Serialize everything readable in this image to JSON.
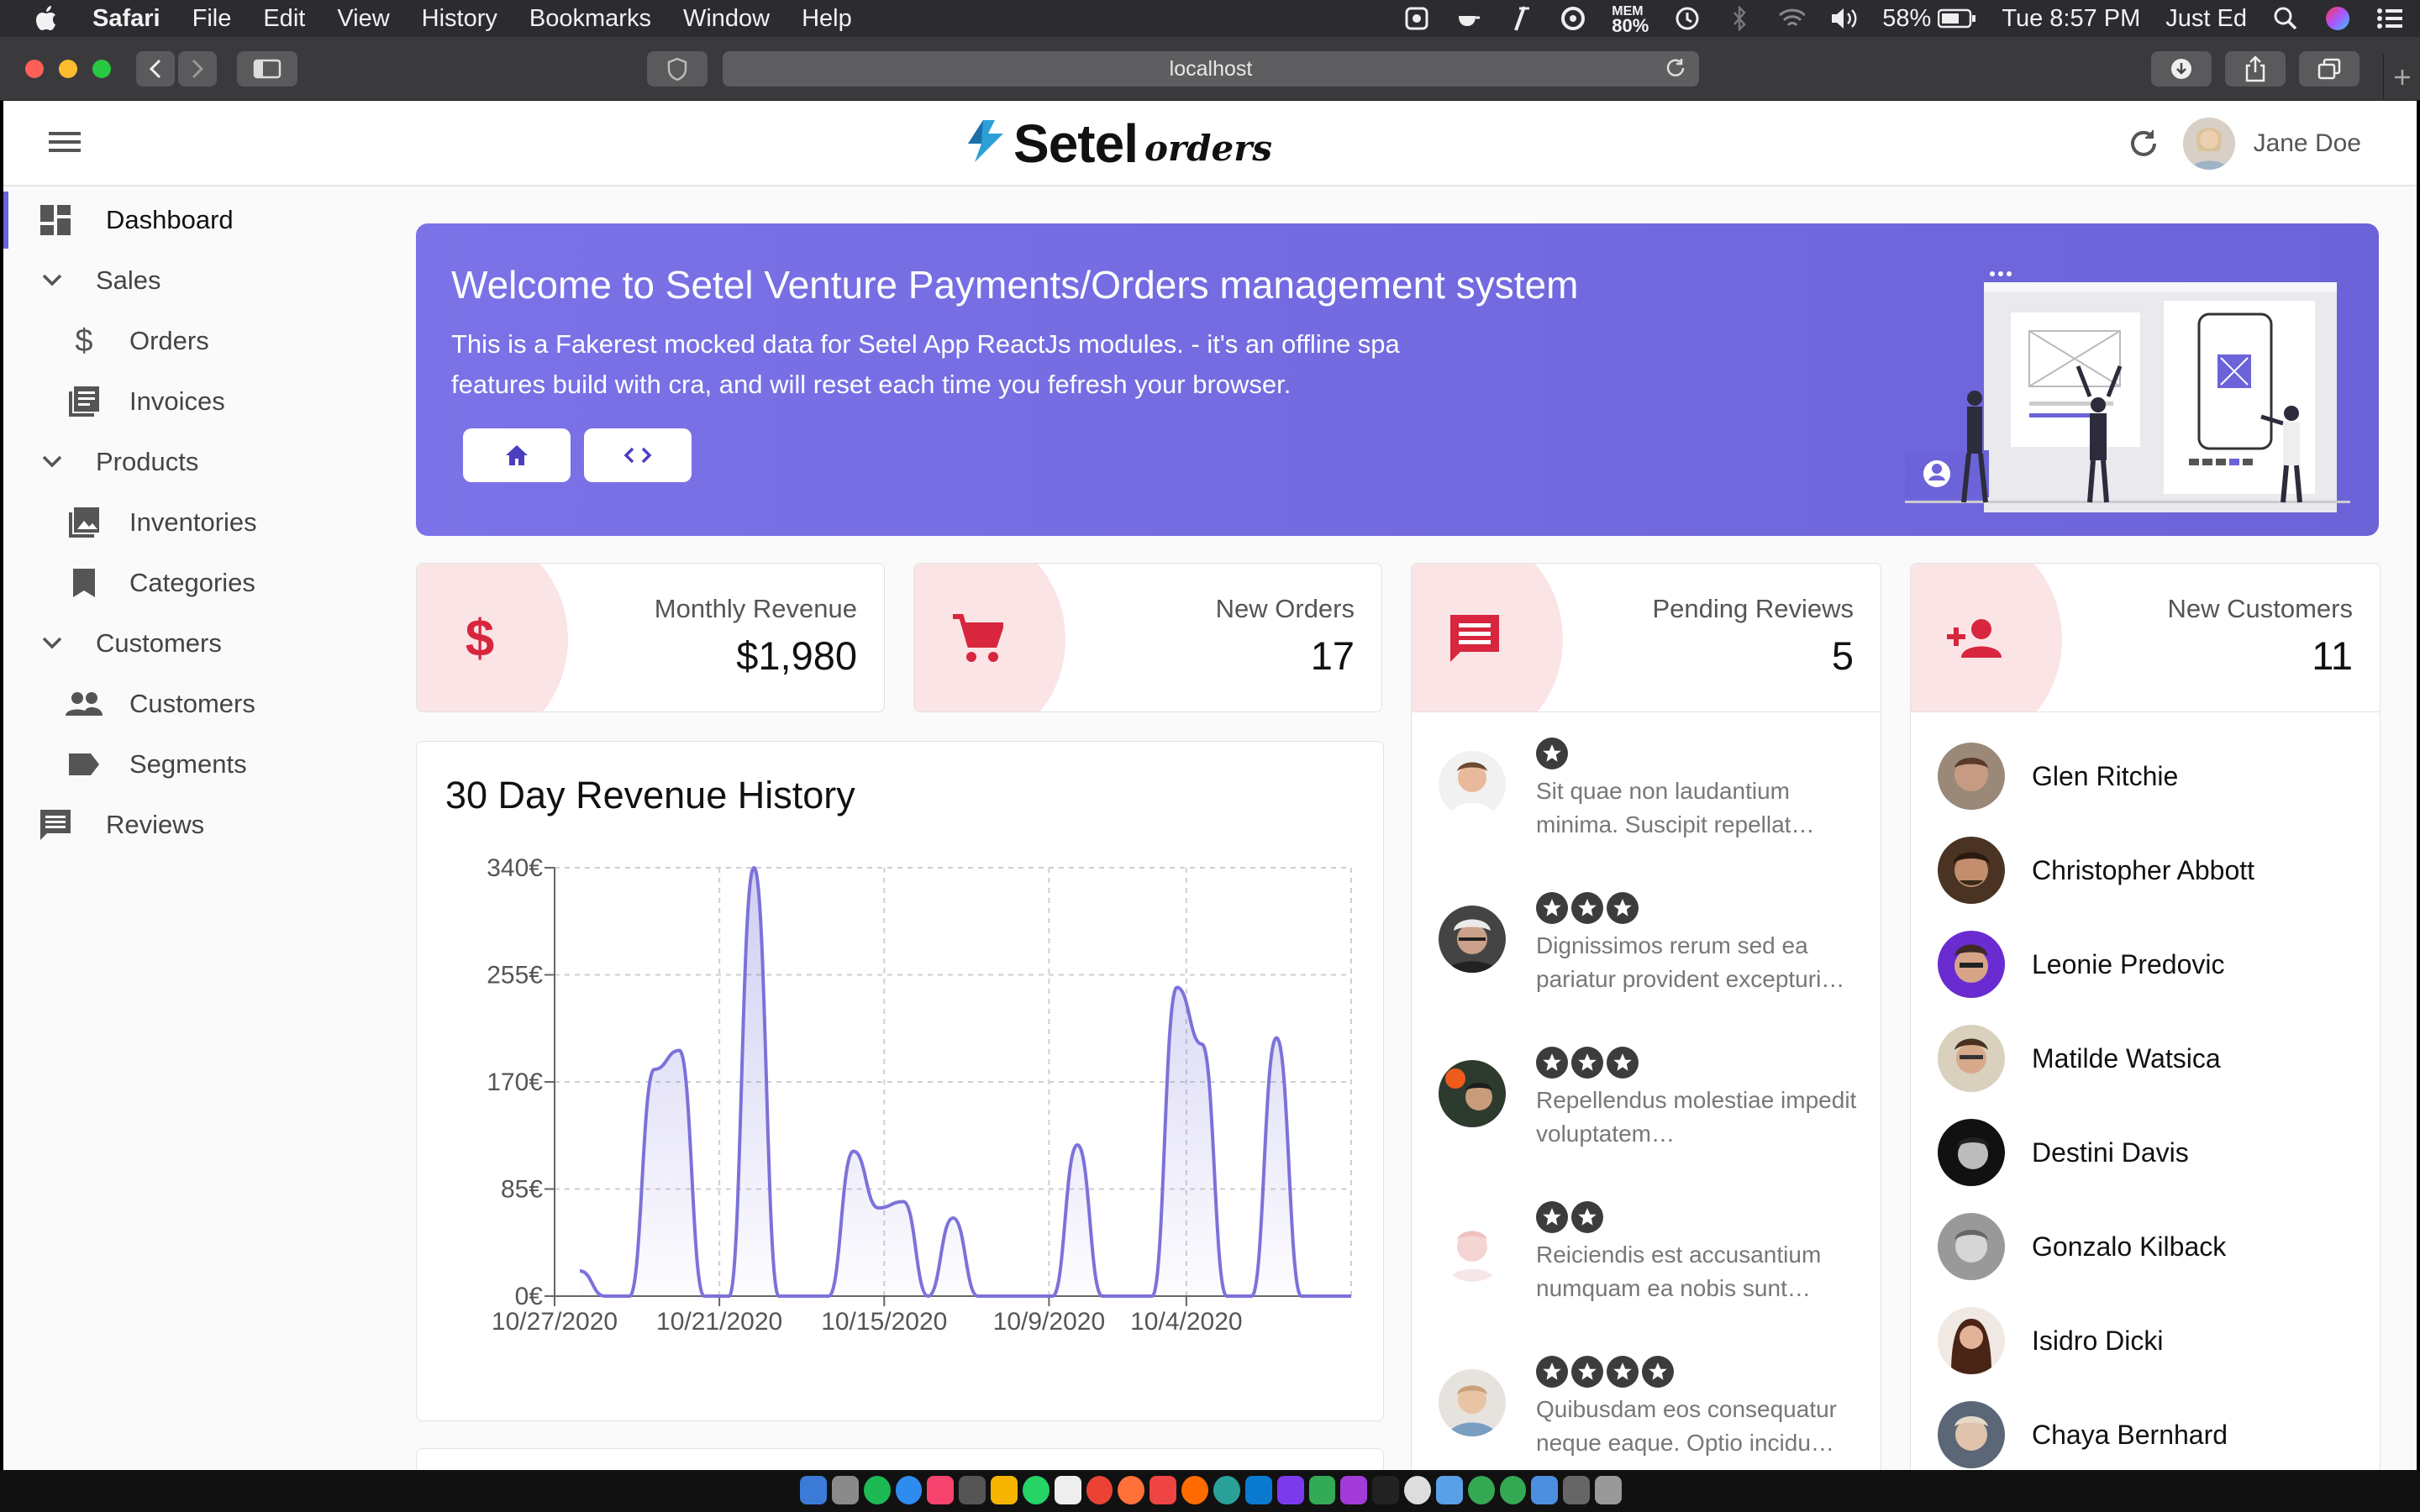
{
  "menubar": {
    "app_name": "Safari",
    "items": [
      "File",
      "Edit",
      "View",
      "History",
      "Bookmarks",
      "Window",
      "Help"
    ],
    "mem_label": "MEM",
    "mem_value": "80%",
    "battery": "58%",
    "datetime": "Tue 8:57 PM",
    "user": "Just Ed"
  },
  "browser": {
    "url": "localhost"
  },
  "header": {
    "logo_brand": "Setel",
    "logo_sub": "orders",
    "user_name": "Jane Doe"
  },
  "sidebar": {
    "items": [
      {
        "label": "Dashboard",
        "icon": "dashboard-icon"
      },
      {
        "label": "Sales",
        "icon": "chevron-down-icon"
      },
      {
        "label": "Orders",
        "icon": "dollar-icon"
      },
      {
        "label": "Invoices",
        "icon": "invoices-icon"
      },
      {
        "label": "Products",
        "icon": "chevron-down-icon"
      },
      {
        "label": "Inventories",
        "icon": "image-icon"
      },
      {
        "label": "Categories",
        "icon": "bookmark-icon"
      },
      {
        "label": "Customers",
        "icon": "chevron-down-icon"
      },
      {
        "label": "Customers",
        "icon": "people-icon"
      },
      {
        "label": "Segments",
        "icon": "label-icon"
      },
      {
        "label": "Reviews",
        "icon": "comment-icon"
      }
    ]
  },
  "banner": {
    "title": "Welcome to Setel Venture Payments/Orders management system",
    "text": "This is a Fakerest mocked data for Setel App ReactJs modules. - it's an offline spa features build with cra, and will reset each time you fefresh your browser."
  },
  "stats": [
    {
      "label": "Monthly Revenue",
      "value": "$1,980",
      "icon": "dollar-icon"
    },
    {
      "label": "New Orders",
      "value": "17",
      "icon": "cart-icon"
    },
    {
      "label": "Pending Reviews",
      "value": "5",
      "icon": "comment-icon"
    },
    {
      "label": "New Customers",
      "value": "11",
      "icon": "person-add-icon"
    }
  ],
  "reviews": [
    {
      "rating": 1,
      "text": "Sit quae non laudantium minima. Suscipit repellat…"
    },
    {
      "rating": 3,
      "text": "Dignissimos rerum sed ea pariatur provident excepturi…"
    },
    {
      "rating": 3,
      "text": "Repellendus molestiae impedit voluptatem…"
    },
    {
      "rating": 2,
      "text": "Reiciendis est accusantium numquam ea nobis sunt…"
    },
    {
      "rating": 4,
      "text": "Quibusdam eos consequatur neque eaque. Optio incidu…"
    }
  ],
  "customers": [
    {
      "name": "Glen Ritchie"
    },
    {
      "name": "Christopher Abbott"
    },
    {
      "name": "Leonie Predovic"
    },
    {
      "name": "Matilde Watsica"
    },
    {
      "name": "Destini Davis"
    },
    {
      "name": "Gonzalo Kilback"
    },
    {
      "name": "Isidro Dicki"
    },
    {
      "name": "Chaya Bernhard"
    }
  ],
  "colors": {
    "accent": "#6c63d8",
    "stat_icon": "#d7263d",
    "line": "#7b72d9"
  },
  "chart_title": "30 Day Revenue History",
  "chart_data": {
    "type": "area",
    "title": "30 Day Revenue History",
    "xlabel": "",
    "ylabel": "",
    "ylim": [
      0,
      340
    ],
    "y_ticks": [
      "0€",
      "85€",
      "170€",
      "255€",
      "340€"
    ],
    "x_tick_labels": [
      "10/27/2020",
      "10/21/2020",
      "10/15/2020",
      "10/9/2020",
      "10/4/2020"
    ],
    "x_tick_days": [
      0,
      6,
      12,
      18,
      23
    ],
    "days_total": 29,
    "series": [
      {
        "values": [
          20,
          0,
          0,
          180,
          195,
          0,
          0,
          340,
          0,
          0,
          0,
          115,
          70,
          75,
          0,
          62,
          0,
          0,
          0,
          0,
          120,
          0,
          0,
          0,
          245,
          200,
          0,
          0,
          205,
          0,
          0,
          0
        ]
      }
    ],
    "grid": true
  }
}
